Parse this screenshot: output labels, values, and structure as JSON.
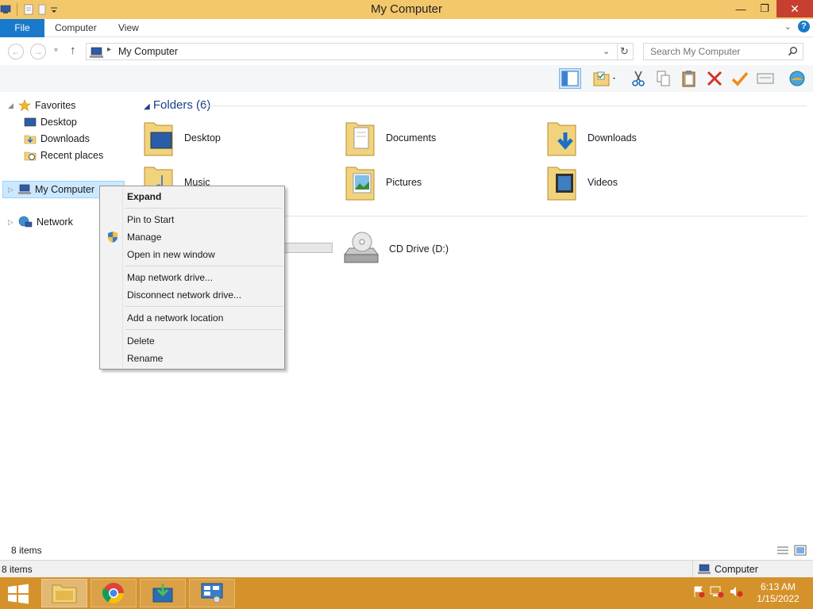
{
  "window": {
    "title": "My Computer"
  },
  "ribbon": {
    "tabs": [
      "File",
      "Computer",
      "View"
    ]
  },
  "address": {
    "path": "My Computer"
  },
  "search": {
    "placeholder": "Search My Computer"
  },
  "nav": {
    "favorites": "Favorites",
    "favorite_items": [
      "Desktop",
      "Downloads",
      "Recent places"
    ],
    "my_computer": "My Computer",
    "network": "Network"
  },
  "content": {
    "folders_header": "Folders (6)",
    "folders": [
      "Desktop",
      "Documents",
      "Downloads",
      "Music",
      "Pictures",
      "Videos"
    ],
    "drives": [
      "CD Drive (D:)"
    ]
  },
  "context_menu": {
    "items": [
      "Expand",
      "Pin to Start",
      "Manage",
      "Open in new window",
      "Map network drive...",
      "Disconnect network drive...",
      "Add a network location",
      "Delete",
      "Rename"
    ]
  },
  "status": {
    "items": "8 items",
    "bottom_items": "8 items",
    "zone": "Computer"
  },
  "taskbar": {
    "time": "6:13 AM",
    "date": "1/15/2022"
  },
  "colors": {
    "title_bar": "#f3c76b",
    "accent": "#1979ca",
    "taskbar": "#d5922a",
    "close": "#c7402f"
  }
}
